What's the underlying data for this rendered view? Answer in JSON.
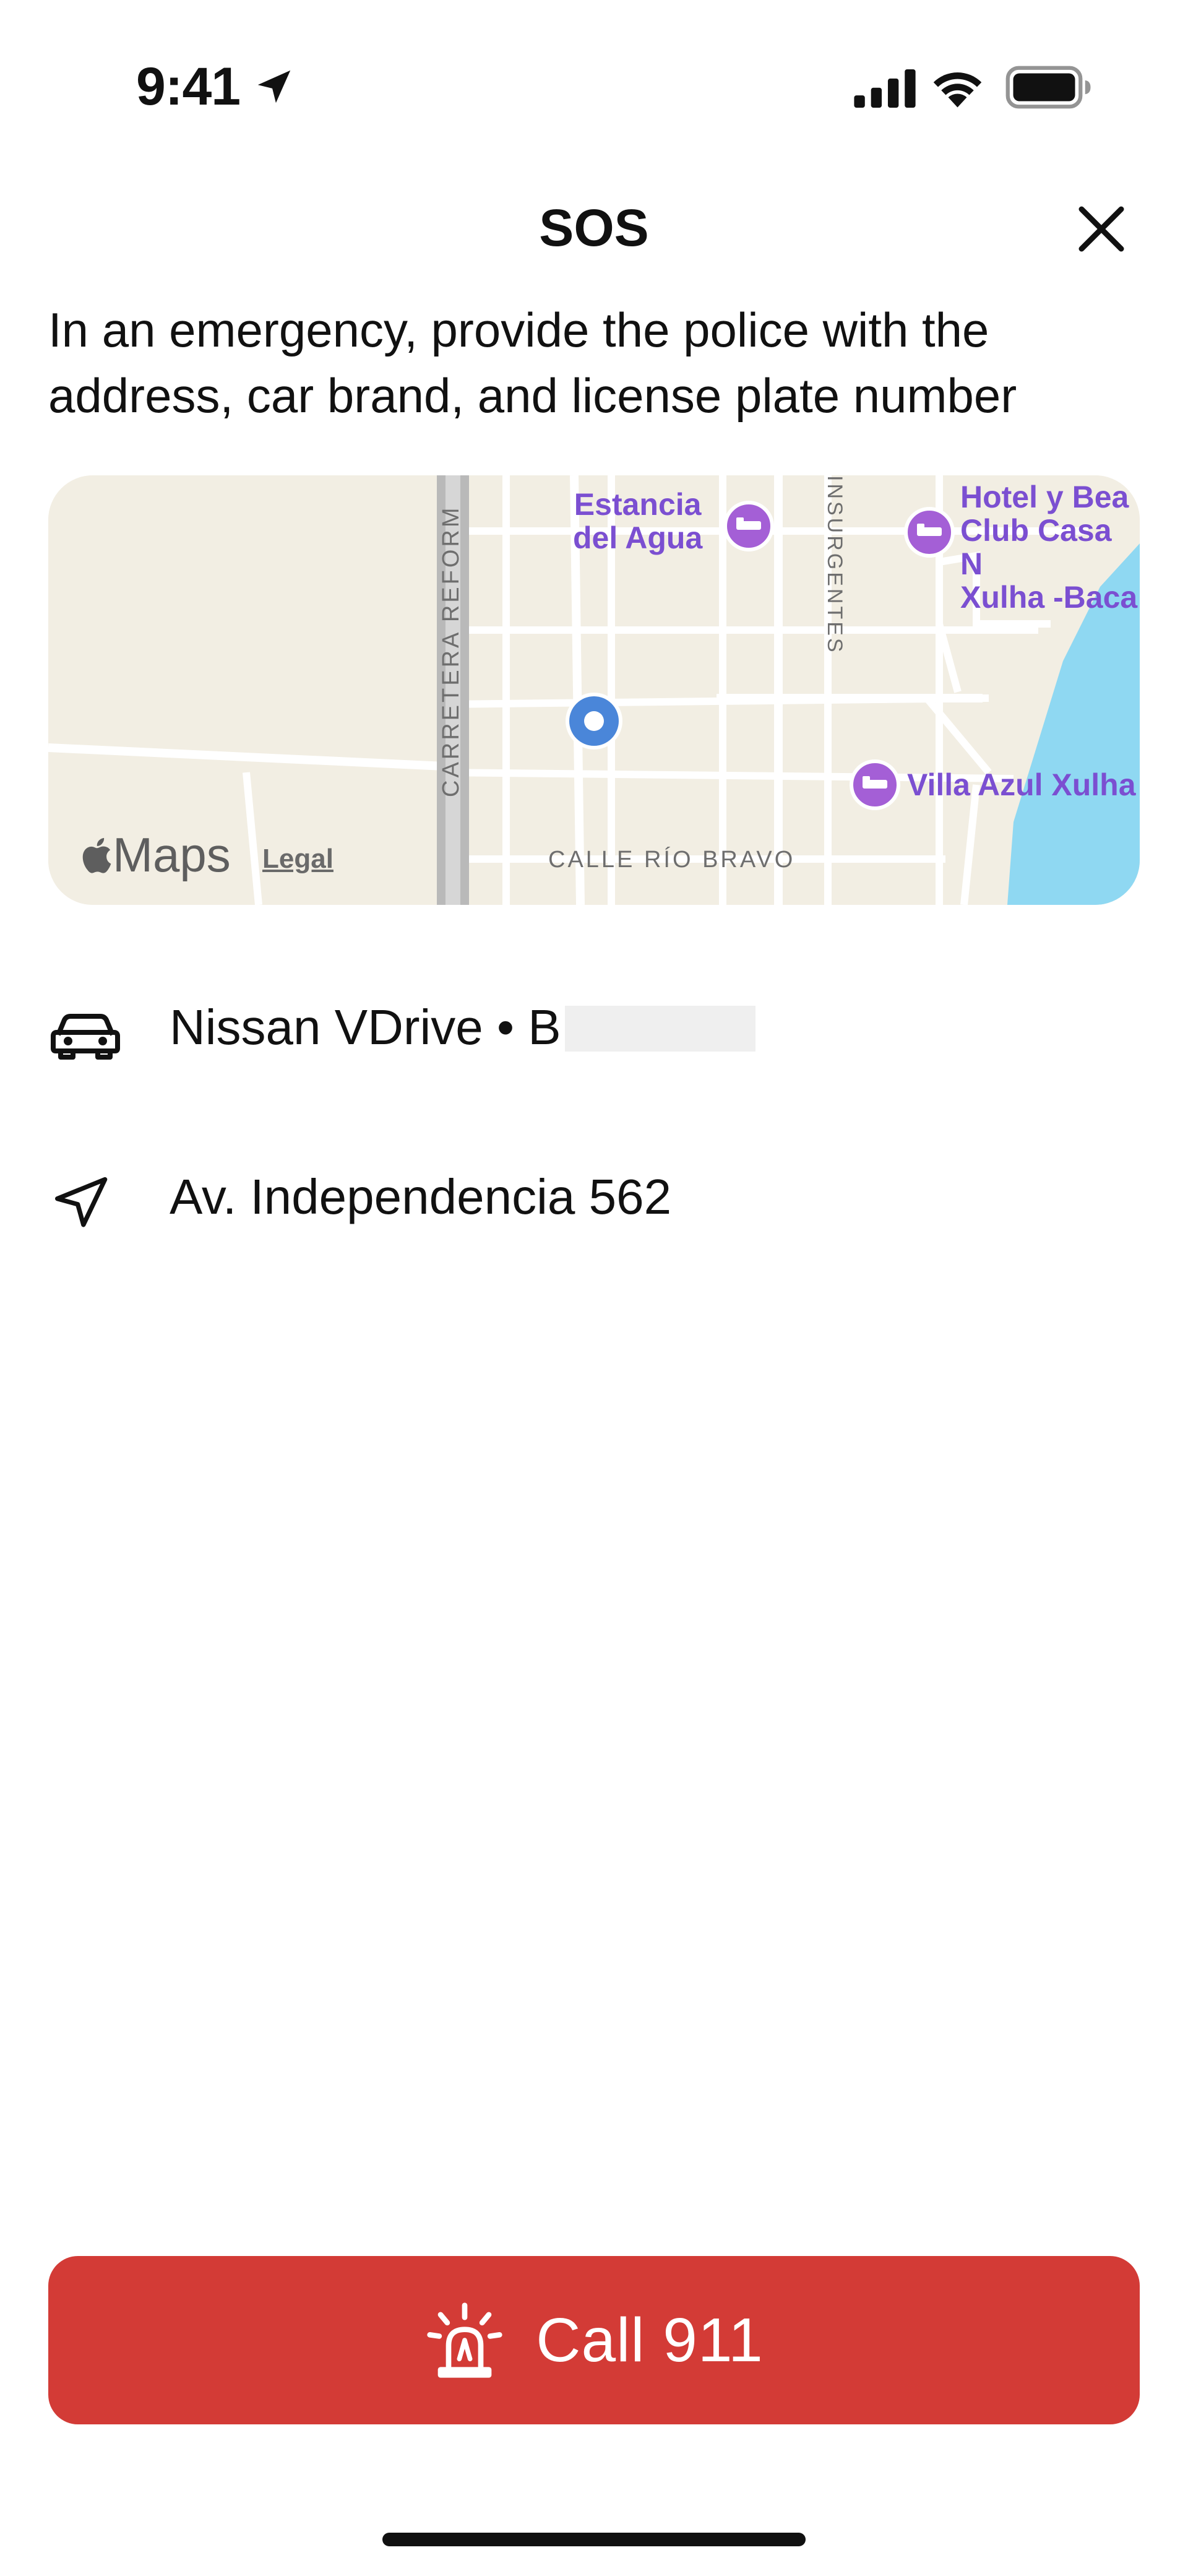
{
  "status_bar": {
    "time": "9:41",
    "icons": [
      "location-arrow-icon",
      "cellular-signal-icon",
      "wifi-icon",
      "battery-icon"
    ]
  },
  "header": {
    "title": "SOS",
    "close_icon": "close-icon"
  },
  "description": "In an emergency, provide the police with the address, car brand, and license plate number",
  "map": {
    "places": [
      {
        "line1": "Estancia",
        "line2": "del Agua"
      },
      {
        "line1": "Hotel y Bea",
        "line2": "Club Casa N",
        "line3": "Xulha -Baca"
      },
      {
        "line1": "Villa Azul Xulha"
      }
    ],
    "streets": {
      "vertical_left": "CARRETERA REFORM",
      "vertical_right": "INSURGENTES",
      "horizontal": "CALLE RÍO BRAVO"
    },
    "brand": "Maps",
    "legal": "Legal",
    "colors": {
      "land": "#f2eee3",
      "road": "#ffffff",
      "highway": "#b9b9b9",
      "water": "#8fd8f2",
      "poi": "#a45fd6",
      "user_dot": "#4a86d9"
    }
  },
  "vehicle": {
    "icon": "car-icon",
    "text": "Nissan VDrive • B"
  },
  "address": {
    "icon": "navigation-arrow-icon",
    "text": "Av. Independencia 562"
  },
  "call_button": {
    "label": "Call 911",
    "icon": "siren-icon",
    "color": "#d33b36"
  }
}
